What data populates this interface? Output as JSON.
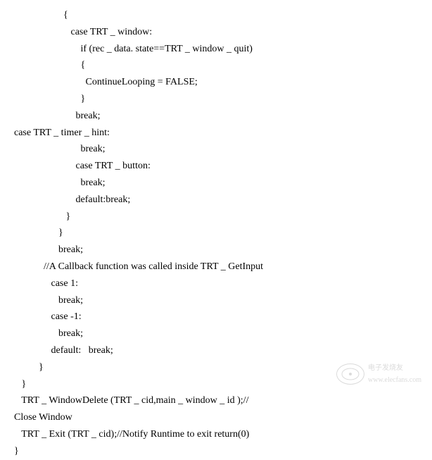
{
  "code": {
    "lines": [
      "                    {",
      "                       case TRT _ window:",
      "                           if (rec _ data. state==TRT _ window _ quit)",
      "                           {",
      "                             ContinueLooping = FALSE;",
      "                           }",
      "                         break;",
      "case TRT _ timer _ hint:",
      "                           break;",
      "                         case TRT _ button:",
      "                           break;",
      "                         default:break;",
      "                     }",
      "                  }",
      "                  break;",
      "            //A Callback function was called inside TRT _ GetInput",
      "               case 1:",
      "                  break;",
      "               case -1:",
      "                  break;",
      "               default:   break;",
      "          }",
      "   }",
      "   TRT _ WindowDelete (TRT _ cid,main _ window _ id );//",
      "Close Window",
      "   TRT _ Exit (TRT _ cid);//Notify Runtime to exit return(0)",
      "}"
    ]
  },
  "watermark": {
    "line1": "电子发烧友",
    "line2": "www.elecfans.com"
  }
}
